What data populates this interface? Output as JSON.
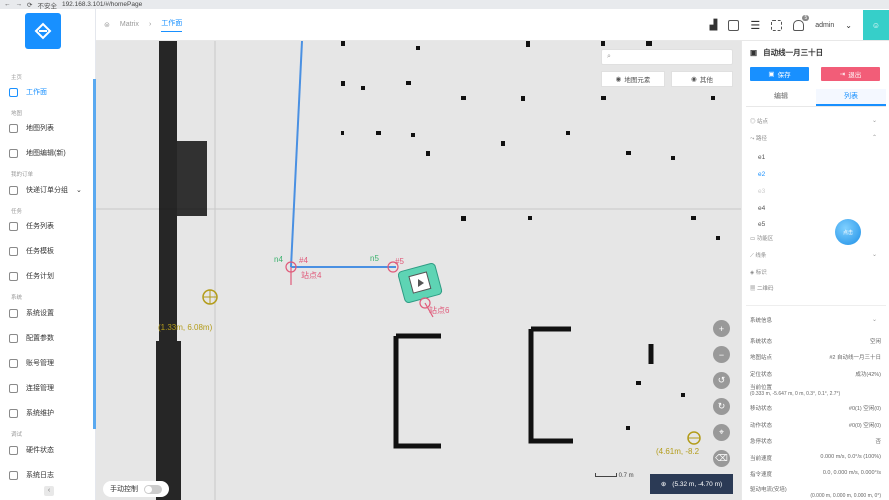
{
  "browser": {
    "not_secure": "不安全",
    "url": "192.168.3.101/#/homePage"
  },
  "sidebar": {
    "sections": [
      {
        "label": "主页"
      },
      {
        "label": "地图"
      },
      {
        "label": "我的订单"
      },
      {
        "label": "任务"
      },
      {
        "label": "系统"
      },
      {
        "label": "调试"
      }
    ],
    "items": [
      {
        "label": "工作面",
        "active": true
      },
      {
        "label": "地图列表"
      },
      {
        "label": "地图编辑(新)"
      },
      {
        "label": "快递订单分组"
      },
      {
        "label": "任务列表"
      },
      {
        "label": "任务模板"
      },
      {
        "label": "任务计划"
      },
      {
        "label": "系统设置"
      },
      {
        "label": "配置参数"
      },
      {
        "label": "账号管理"
      },
      {
        "label": "连接管理"
      },
      {
        "label": "系统维护"
      },
      {
        "label": "硬件状态"
      },
      {
        "label": "系统日志"
      }
    ],
    "collapse": "‹"
  },
  "header": {
    "breadcrumb": [
      "Matrix",
      "工作面"
    ],
    "notification_count": "5",
    "user": "admin"
  },
  "map": {
    "buttons": {
      "elements": "地图元素",
      "other": "其他"
    },
    "labels": {
      "n4": "n4",
      "n5": "n5",
      "p4": "#4",
      "p5": "#5",
      "station4": "站点4",
      "station6": "站点6",
      "coord_left": "(1.33m, 6.08m)",
      "coord_right": "(4.61m, -8.2"
    },
    "manual_control": "手动控制",
    "scale": "0.7 m",
    "robot_position": "(5.32 m, -4.70 m)"
  },
  "panel": {
    "title": "自动线一月三十日",
    "save": "保存",
    "exit": "退出",
    "tab_edit": "编辑",
    "tab_list": "列表",
    "groups": {
      "stations": "站点",
      "paths": "路径",
      "areas": "功能区",
      "lines": "线条",
      "marks": "标识",
      "codes": "二维码"
    },
    "edges": [
      "e1",
      "e2",
      "e3",
      "e4",
      "e5"
    ],
    "status_title": "系统信息",
    "status": [
      {
        "k": "系统状态",
        "v": "空闲"
      },
      {
        "k": "地图站点",
        "v": "#2 自动线一月三十日"
      },
      {
        "k": "定位状态",
        "v": "成功(42%)"
      },
      {
        "k": "当前位置",
        "v": "(0.333 m, -5.647 m, 0 m, 0.3°, 0.1°, 2.7°)"
      },
      {
        "k": "移动状态",
        "v": "#0(1) 空闲(0)"
      },
      {
        "k": "动作状态",
        "v": "#0(0) 空闲(0)"
      },
      {
        "k": "急停状态",
        "v": "否"
      },
      {
        "k": "当前速度",
        "v": "0.000 m/s, 0.0°/s (100%)"
      },
      {
        "k": "指令速度",
        "v": "0.0, 0.000 m/s, 0.000°/s"
      },
      {
        "k": "驱动电流(安培)",
        "v": "(0.000 m, 0.000 m, 0.000 m, 0°)"
      }
    ],
    "ball": "点击"
  }
}
